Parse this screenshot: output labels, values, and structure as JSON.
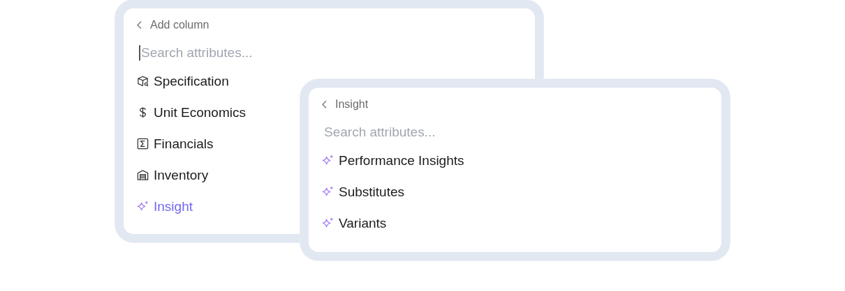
{
  "panels": [
    {
      "back_label": "Add column",
      "search": {
        "placeholder": "Search attributes...",
        "focused": true
      },
      "items": [
        {
          "kind": "box",
          "label": "Specification",
          "selected": false
        },
        {
          "kind": "dollar",
          "label": "Unit Economics",
          "selected": false
        },
        {
          "kind": "sigma",
          "label": "Financials",
          "selected": false
        },
        {
          "kind": "warehouse",
          "label": "Inventory",
          "selected": false
        },
        {
          "kind": "sparkle",
          "label": "Insight",
          "selected": true
        }
      ]
    },
    {
      "back_label": "Insight",
      "search": {
        "placeholder": "Search attributes...",
        "focused": false
      },
      "items": [
        {
          "kind": "sparkle",
          "label": "Performance Insights",
          "selected": false
        },
        {
          "kind": "sparkle",
          "label": "Substitutes",
          "selected": false
        },
        {
          "kind": "sparkle",
          "label": "Variants",
          "selected": false
        }
      ]
    }
  ]
}
